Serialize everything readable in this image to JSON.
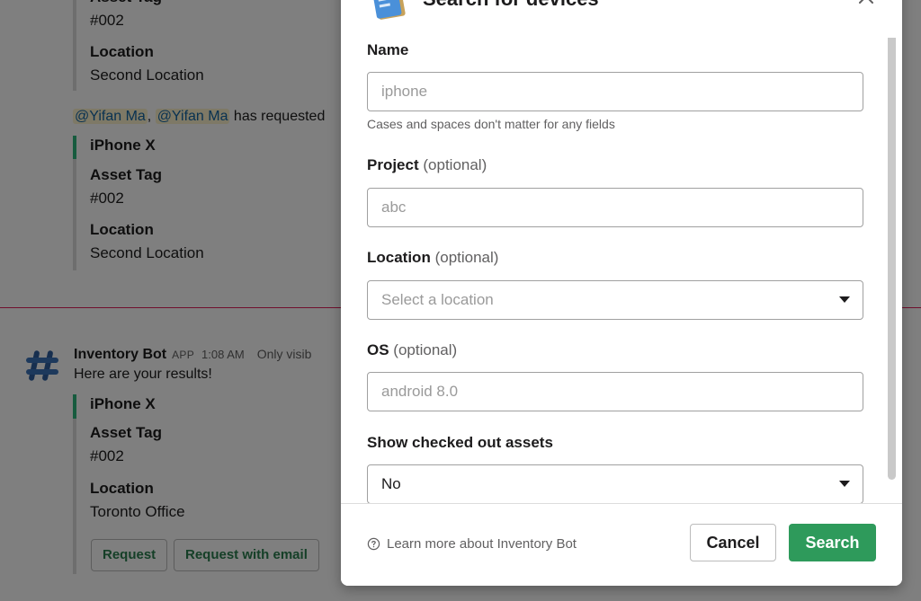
{
  "chat": {
    "block1": {
      "asset_tag_label": "Asset Tag",
      "asset_tag_value": "#002",
      "location_label": "Location",
      "location_value": "Second Location"
    },
    "request_msg": {
      "mention1": "@Yifan Ma",
      "separator": ", ",
      "mention2": "@Yifan Ma",
      "text": " has requested"
    },
    "block2": {
      "title": "iPhone X",
      "asset_tag_label": "Asset Tag",
      "asset_tag_value": "#002",
      "location_label": "Location",
      "location_value": "Second Location"
    },
    "bot_msg": {
      "name": "Inventory Bot",
      "badge": "APP",
      "time": "1:08 AM",
      "visibility": "Only visib",
      "text": "Here are your results!",
      "title": "iPhone X",
      "asset_tag_label": "Asset Tag",
      "asset_tag_value": "#002",
      "location_label": "Location",
      "location_value": "Toronto Office",
      "request_button": "Request",
      "request_email_button": "Request with email"
    }
  },
  "modal": {
    "title": "Search for devices",
    "name": {
      "label": "Name",
      "placeholder": "iphone",
      "hint": "Cases and spaces don't matter for any fields"
    },
    "project": {
      "label": "Project",
      "optional": "(optional)",
      "placeholder": "abc"
    },
    "location": {
      "label": "Location",
      "optional": "(optional)",
      "placeholder": "Select a location"
    },
    "os": {
      "label": "OS",
      "optional": "(optional)",
      "placeholder": "android 8.0"
    },
    "checked_out": {
      "label": "Show checked out assets",
      "value": "No"
    },
    "footer": {
      "learn_more": "Learn more about Inventory Bot",
      "cancel": "Cancel",
      "search": "Search"
    }
  },
  "colors": {
    "accent_green": "#2e9a5b",
    "attachment_bar": "#2eb67d",
    "new_divider": "#e01e5a",
    "mention_bg": "#fdf3cc",
    "mention_text": "#1264a3"
  },
  "icons": [
    "inventory-bot-avatar-icon",
    "notebook-app-icon",
    "close-icon",
    "chevron-down-icon",
    "question-circle-icon"
  ]
}
